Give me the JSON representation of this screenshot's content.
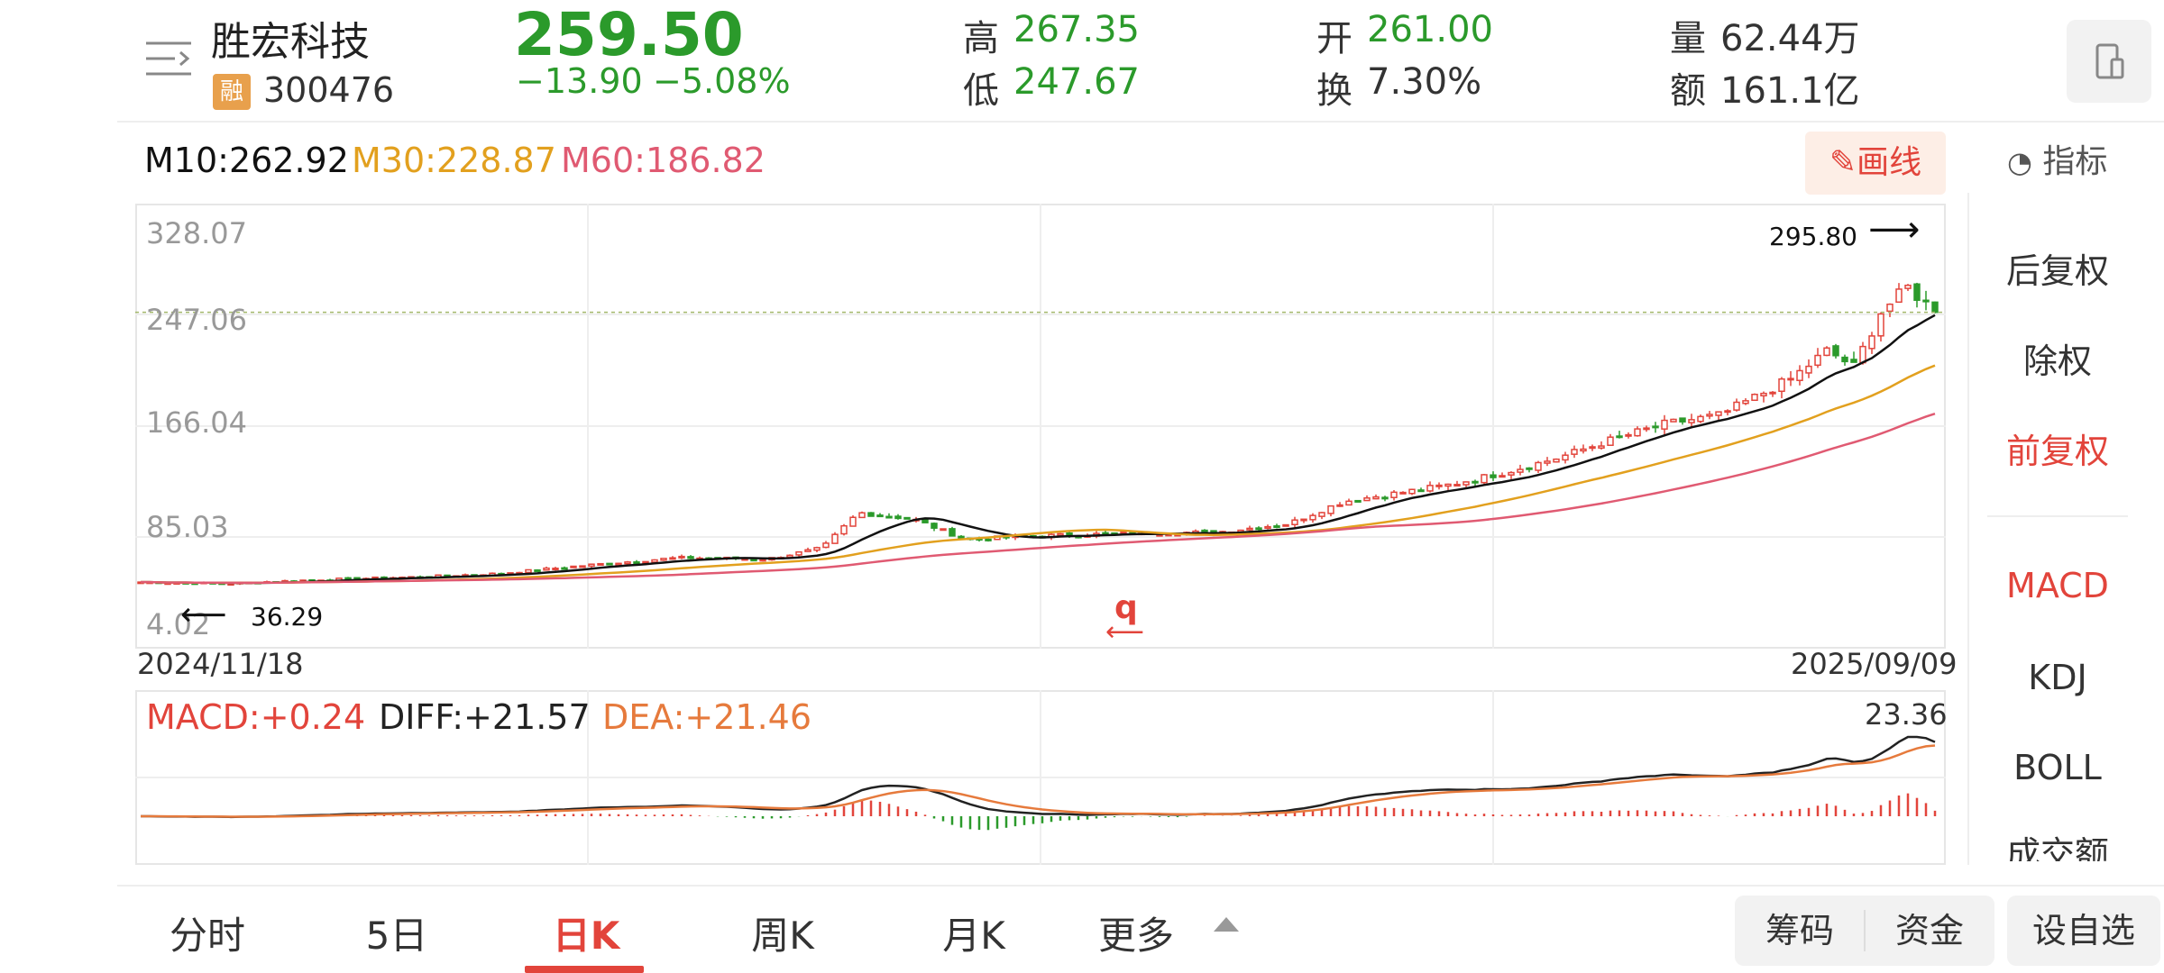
{
  "stock": {
    "name": "胜宏科技",
    "badge": "融",
    "code": "300476",
    "price": "259.50",
    "change": "−13.90",
    "change_pct": "−5.08%"
  },
  "quote": {
    "high_label": "高",
    "high": "267.35",
    "low_label": "低",
    "low": "247.67",
    "open_label": "开",
    "open": "261.00",
    "turnover_label": "换",
    "turnover": "7.30%",
    "volume_label": "量",
    "volume": "62.44万",
    "amount_label": "额",
    "amount": "161.1亿"
  },
  "ma": {
    "m10": "M10:262.92",
    "m30": "M30:228.87",
    "m60": "M60:186.82"
  },
  "draw_button": "画线",
  "indicator_button": "指标",
  "chart_data": {
    "type": "candlestick",
    "title": "",
    "y_ticks": [
      "328.07",
      "247.06",
      "166.04",
      "85.03",
      "4.02"
    ],
    "ylim": [
      4.02,
      328.07
    ],
    "x_start": "2024/11/18",
    "x_end": "2025/09/09",
    "max_label": "295.80",
    "min_label": "36.29",
    "center_marker": "q",
    "current_price": 259.5,
    "ma_colors": {
      "m10": "#111111",
      "m30": "#e2a01e",
      "m60": "#e05a72"
    },
    "close_path": [
      [
        0,
        38
      ],
      [
        0.05,
        37
      ],
      [
        0.1,
        40
      ],
      [
        0.15,
        42
      ],
      [
        0.2,
        45
      ],
      [
        0.25,
        52
      ],
      [
        0.3,
        58
      ],
      [
        0.35,
        57
      ],
      [
        0.38,
        66
      ],
      [
        0.4,
        95
      ],
      [
        0.43,
        90
      ],
      [
        0.46,
        73
      ],
      [
        0.5,
        76
      ],
      [
        0.55,
        78
      ],
      [
        0.6,
        79
      ],
      [
        0.64,
        86
      ],
      [
        0.67,
        104
      ],
      [
        0.7,
        111
      ],
      [
        0.73,
        118
      ],
      [
        0.76,
        128
      ],
      [
        0.79,
        140
      ],
      [
        0.82,
        155
      ],
      [
        0.85,
        168
      ],
      [
        0.88,
        175
      ],
      [
        0.9,
        190
      ],
      [
        0.92,
        205
      ],
      [
        0.94,
        228
      ],
      [
        0.955,
        215
      ],
      [
        0.97,
        260
      ],
      [
        0.985,
        280
      ],
      [
        1.0,
        259.5
      ]
    ]
  },
  "macd": {
    "macd_label": "MACD:+0.24",
    "diff_label": "DIFF:+21.57",
    "dea_label": "DEA:+21.46",
    "max_value": "23.36"
  },
  "side_menu": {
    "items": [
      "后复权",
      "除权",
      "前复权"
    ],
    "active": "前复权",
    "indicators": [
      "MACD",
      "KDJ",
      "BOLL",
      "成交额"
    ],
    "active_indicator": "MACD"
  },
  "tabs": {
    "items": [
      "分时",
      "5日",
      "日K",
      "周K",
      "月K",
      "更多"
    ],
    "active": "日K"
  },
  "bottom_buttons": {
    "chips": "筹码",
    "funds": "资金",
    "watchlist": "设自选"
  },
  "colors": {
    "up": "#e2443b",
    "down": "#2b9a2b",
    "accent": "#e2443b"
  }
}
